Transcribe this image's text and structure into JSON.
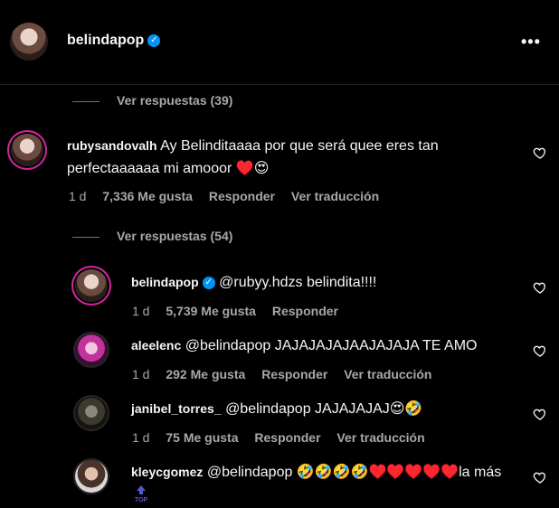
{
  "header": {
    "username": "belindapop",
    "verified": "✓",
    "more": "•••"
  },
  "replies_toggles": [
    {
      "label": "Ver respuestas (39)"
    },
    {
      "label": "Ver respuestas (54)"
    }
  ],
  "main_comment": {
    "username": "rubysandovalh",
    "text_line1": "Ay Belinditaaaa por que será quee eres tan",
    "text_line2": "perfectaaaaaa mi amooor ♥️😍",
    "time": "1 d",
    "likes": "7,336 Me gusta",
    "reply": "Responder",
    "translate": "Ver traducción"
  },
  "replies": [
    {
      "username": "belindapop",
      "verified": "✓",
      "text": "@rubyy.hdzs belindita!!!!",
      "time": "1 d",
      "likes": "5,739 Me gusta",
      "reply": "Responder",
      "translate": ""
    },
    {
      "username": "aleelenc",
      "text": "@belindapop JAJAJAJAJAAJAJAJA TE AMO",
      "time": "1 d",
      "likes": "292 Me gusta",
      "reply": "Responder",
      "translate": "Ver traducción"
    },
    {
      "username": "janibel_torres_",
      "text": "@belindapop JAJAJAJAJ😍🤣",
      "time": "1 d",
      "likes": "75 Me gusta",
      "reply": "Responder",
      "translate": "Ver traducción"
    },
    {
      "username": "kleycgomez",
      "text": "@belindapop 🤣🤣🤣🤣♥️♥️♥️♥️♥️la más"
    }
  ],
  "top_badge": "TOP"
}
